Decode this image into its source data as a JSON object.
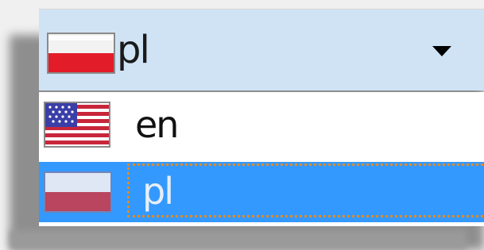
{
  "combobox": {
    "selected_value": "pl",
    "selected_flag": "poland-flag-icon",
    "arrow_icon": "dropdown-arrow-icon"
  },
  "dropdown": {
    "options": [
      {
        "label": "en",
        "flag": "usa-flag-icon",
        "selected": false
      },
      {
        "label": "pl",
        "flag": "poland-flag-icon",
        "selected": true
      }
    ]
  },
  "colors": {
    "combo_background": "#cfe3f5",
    "selection_highlight": "#3399ff",
    "focus_outline": "#e38a26",
    "poland_red": "#e31c2a"
  }
}
